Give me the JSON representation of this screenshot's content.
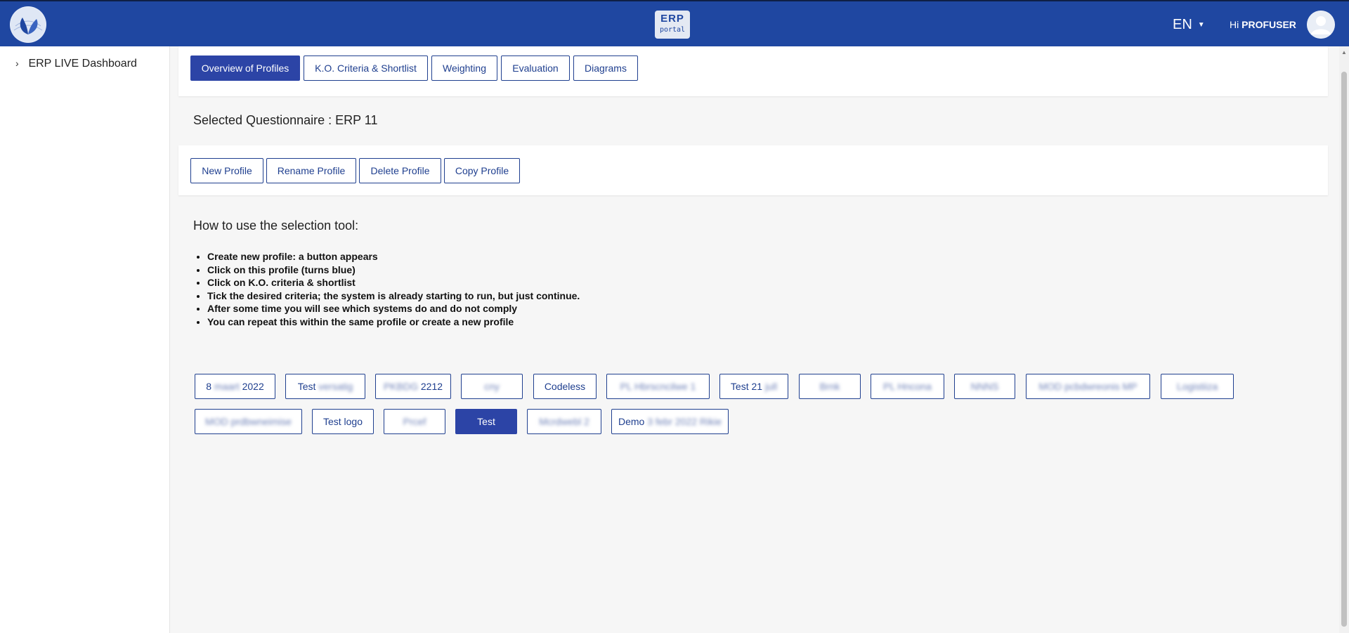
{
  "header": {
    "logo_top": "ERP",
    "logo_bottom": "portal",
    "language": "EN",
    "greeting": "Hi",
    "username": "PROFUSER"
  },
  "sidebar": {
    "items": [
      {
        "label": "ERP LIVE Dashboard"
      }
    ]
  },
  "tabs": [
    {
      "label": "Overview of Profiles",
      "active": true
    },
    {
      "label": "K.O. Criteria & Shortlist",
      "active": false
    },
    {
      "label": "Weighting",
      "active": false
    },
    {
      "label": "Evaluation",
      "active": false
    },
    {
      "label": "Diagrams",
      "active": false
    }
  ],
  "questionnaire_label": "Selected Questionnaire : ERP 11",
  "actions": {
    "new_profile": "New Profile",
    "rename_profile": "Rename Profile",
    "delete_profile": "Delete Profile",
    "copy_profile": "Copy Profile"
  },
  "howto": {
    "title": "How to use the selection tool:",
    "steps": [
      "Create new profile: a button appears",
      "Click on this profile (turns blue)",
      "Click on K.O. criteria & shortlist",
      "Tick the desired criteria; the system is already starting to run, but just continue.",
      "After some time you will see which systems do and do not comply",
      "You can repeat this within the same profile or create a new profile"
    ]
  },
  "profiles": [
    {
      "visible": "8",
      "blurred": "maart",
      "suffix": "2022",
      "selected": false
    },
    {
      "visible": "Test",
      "blurred": "versatig",
      "suffix": "",
      "selected": false
    },
    {
      "visible": "",
      "blurred": "PKBDG",
      "suffix": "2212",
      "selected": false
    },
    {
      "visible": "",
      "blurred": "cny",
      "suffix": "",
      "selected": false
    },
    {
      "visible": "Codeless",
      "blurred": "",
      "suffix": "",
      "selected": false
    },
    {
      "visible": "",
      "blurred": "PL Hbrscncilwe 1",
      "suffix": "",
      "selected": false
    },
    {
      "visible": "Test 21",
      "blurred": "jull",
      "suffix": "",
      "selected": false
    },
    {
      "visible": "",
      "blurred": "Brnk",
      "suffix": "",
      "selected": false
    },
    {
      "visible": "",
      "blurred": "PL Hncona",
      "suffix": "",
      "selected": false
    },
    {
      "visible": "",
      "blurred": "NNNS",
      "suffix": "",
      "selected": false
    },
    {
      "visible": "",
      "blurred": "MOD pcbdwreonis MP",
      "suffix": "",
      "selected": false
    },
    {
      "visible": "",
      "blurred": "Logistiiza",
      "suffix": "",
      "selected": false
    },
    {
      "visible": "",
      "blurred": "MOD prdbwneimise",
      "suffix": "",
      "selected": false
    },
    {
      "visible": "Test logo",
      "blurred": "",
      "suffix": "",
      "selected": false
    },
    {
      "visible": "",
      "blurred": "Prcef",
      "suffix": "",
      "selected": false
    },
    {
      "visible": "Test",
      "blurred": "",
      "suffix": "",
      "selected": true
    },
    {
      "visible": "",
      "blurred": "Mcrdwebl 2",
      "suffix": "",
      "selected": false
    },
    {
      "visible": "Demo",
      "blurred": "3 febr 2022 Rikie",
      "suffix": "",
      "selected": false
    }
  ]
}
